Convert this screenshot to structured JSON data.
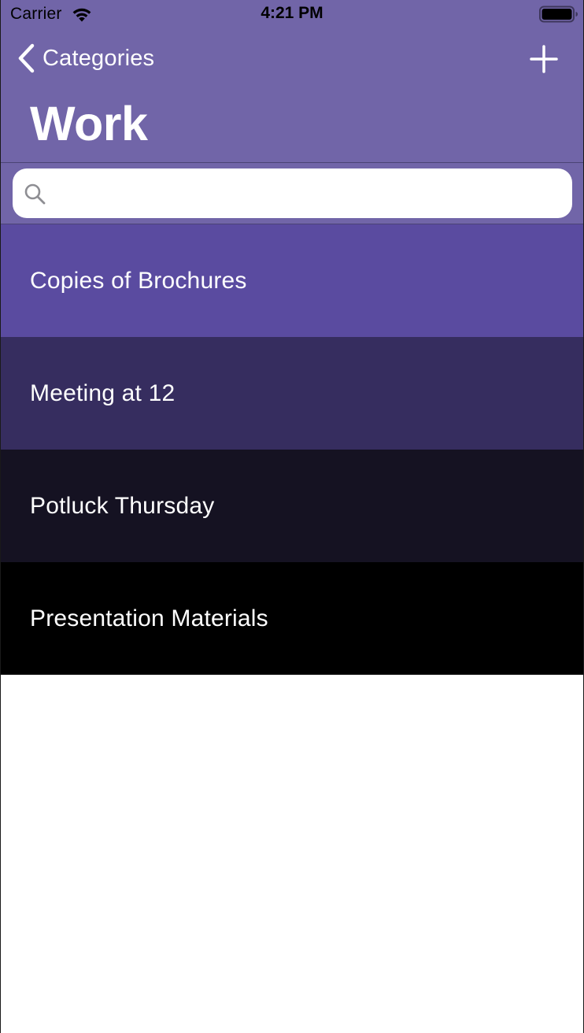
{
  "status_bar": {
    "carrier": "Carrier",
    "time": "4:21 PM",
    "wifi_icon": "wifi-icon",
    "battery_icon": "battery-full-icon"
  },
  "nav": {
    "back_label": "Categories",
    "back_icon": "chevron-left-icon",
    "add_icon": "plus-icon",
    "title": "Work",
    "background_color": "#7165a8"
  },
  "search": {
    "placeholder": "",
    "value": "",
    "icon": "search-icon"
  },
  "items": [
    {
      "label": "Copies of Brochures",
      "color": "#5a4ba0"
    },
    {
      "label": "Meeting at 12",
      "color": "#362d5f"
    },
    {
      "label": "Potluck Thursday",
      "color": "#151222"
    },
    {
      "label": "Presentation Materials",
      "color": "#000000"
    }
  ]
}
